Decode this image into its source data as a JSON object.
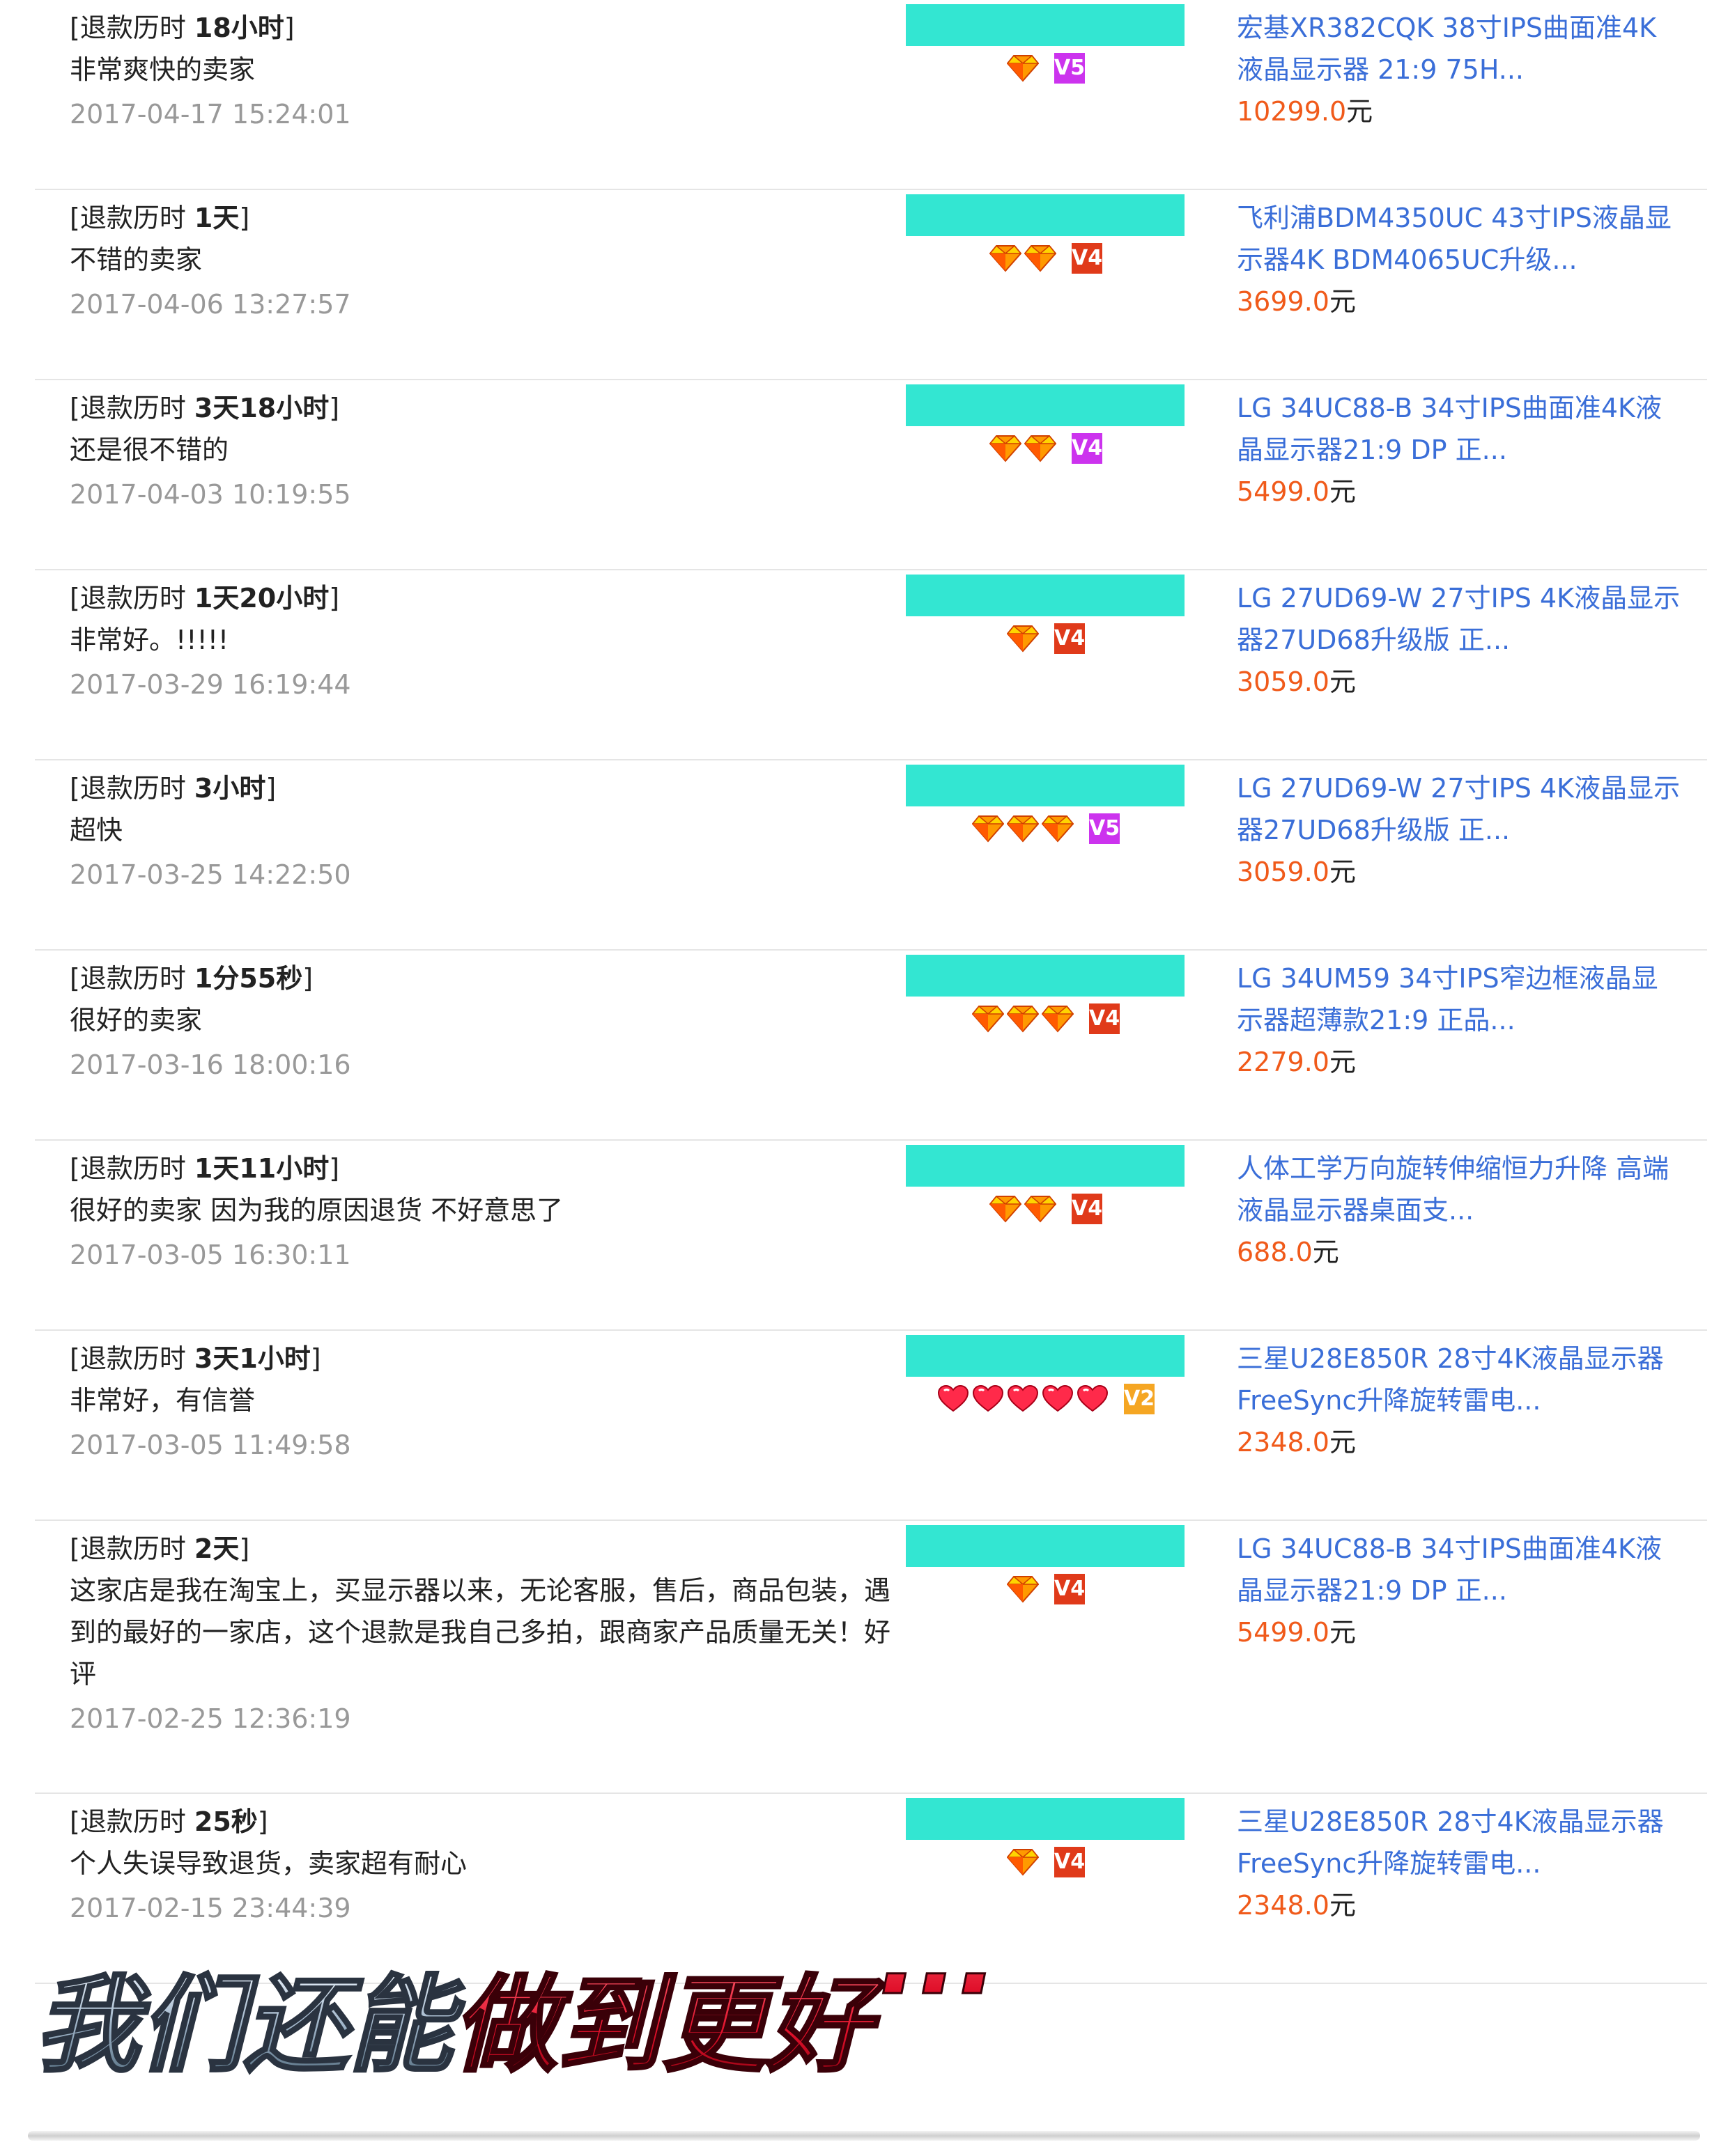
{
  "colors": {
    "bar": "#33e6d2",
    "link": "#3a6ed8",
    "price": "#f05a1a",
    "date": "#999999",
    "badge_purple": "#cc33ee",
    "badge_red": "#e03a1a",
    "badge_orange": "#f5a623"
  },
  "reviews": [
    {
      "refund_prefix": "[退款历时 ",
      "duration": "18小时",
      "refund_suffix": "]",
      "comment": "非常爽快的卖家",
      "date": "2017-04-17 15:24:01",
      "badge": {
        "icon": "diamond-icon",
        "count": 1,
        "level_icon": "v5-purple-badge-icon",
        "level_text": "V5"
      },
      "product": "宏基XR382CQK 38寸IPS曲面准4K液晶显示器 21:9 75H...",
      "price": "10299.0",
      "currency": "元"
    },
    {
      "refund_prefix": "[退款历时 ",
      "duration": "1天",
      "refund_suffix": "]",
      "comment": "不错的卖家",
      "date": "2017-04-06 13:27:57",
      "badge": {
        "icon": "diamond-icon",
        "count": 2,
        "level_icon": "v4-red-badge-icon",
        "level_text": "V4"
      },
      "product": "飞利浦BDM4350UC 43寸IPS液晶显示器4K BDM4065UC升级...",
      "price": "3699.0",
      "currency": "元"
    },
    {
      "refund_prefix": "[退款历时 ",
      "duration": "3天18小时",
      "refund_suffix": "]",
      "comment": "还是很不错的",
      "date": "2017-04-03 10:19:55",
      "badge": {
        "icon": "diamond-icon",
        "count": 2,
        "level_icon": "v4-purple-badge-icon",
        "level_text": "V4"
      },
      "product": "LG 34UC88-B 34寸IPS曲面准4K液晶显示器21:9 DP 正...",
      "price": "5499.0",
      "currency": "元"
    },
    {
      "refund_prefix": "[退款历时 ",
      "duration": "1天20小时",
      "refund_suffix": "]",
      "comment": "非常好。!!!!!",
      "date": "2017-03-29 16:19:44",
      "badge": {
        "icon": "diamond-icon",
        "count": 1,
        "level_icon": "v4-red-badge-icon",
        "level_text": "V4"
      },
      "product": "LG 27UD69-W 27寸IPS 4K液晶显示器27UD68升级版 正...",
      "price": "3059.0",
      "currency": "元"
    },
    {
      "refund_prefix": "[退款历时 ",
      "duration": "3小时",
      "refund_suffix": "]",
      "comment": "超快",
      "date": "2017-03-25 14:22:50",
      "badge": {
        "icon": "diamond-icon",
        "count": 3,
        "level_icon": "v5-purple-badge-icon",
        "level_text": "V5"
      },
      "product": "LG 27UD69-W 27寸IPS 4K液晶显示器27UD68升级版 正...",
      "price": "3059.0",
      "currency": "元"
    },
    {
      "refund_prefix": "[退款历时 ",
      "duration": "1分55秒",
      "refund_suffix": "]",
      "comment": "很好的卖家",
      "date": "2017-03-16 18:00:16",
      "badge": {
        "icon": "diamond-icon",
        "count": 3,
        "level_icon": "v4-red-badge-icon",
        "level_text": "V4"
      },
      "product": "LG 34UM59 34寸IPS窄边框液晶显示器超薄款21:9 正品...",
      "price": "2279.0",
      "currency": "元"
    },
    {
      "refund_prefix": "[退款历时 ",
      "duration": "1天11小时",
      "refund_suffix": "]",
      "comment": "很好的卖家 因为我的原因退货 不好意思了",
      "date": "2017-03-05 16:30:11",
      "badge": {
        "icon": "diamond-icon",
        "count": 2,
        "level_icon": "v4-red-badge-icon",
        "level_text": "V4"
      },
      "product": "人体工学万向旋转伸缩恒力升降 高端液晶显示器桌面支...",
      "price": "688.0",
      "currency": "元"
    },
    {
      "refund_prefix": "[退款历时 ",
      "duration": "3天1小时",
      "refund_suffix": "]",
      "comment": "非常好，有信誉",
      "date": "2017-03-05 11:49:58",
      "badge": {
        "icon": "heart-icon",
        "count": 5,
        "level_icon": "v2-orange-badge-icon",
        "level_text": "V2"
      },
      "product": "三星U28E850R 28寸4K液晶显示器FreeSync升降旋转雷电...",
      "price": "2348.0",
      "currency": "元"
    },
    {
      "refund_prefix": "[退款历时 ",
      "duration": "2天",
      "refund_suffix": "]",
      "comment": "这家店是我在淘宝上，买显示器以来，无论客服，售后，商品包装，遇到的最好的一家店，这个退款是我自己多拍，跟商家产品质量无关！好评",
      "date": "2017-02-25 12:36:19",
      "badge": {
        "icon": "diamond-icon",
        "count": 1,
        "level_icon": "v4-red-badge-icon",
        "level_text": "V4"
      },
      "product": "LG 34UC88-B 34寸IPS曲面准4K液晶显示器21:9 DP 正...",
      "price": "5499.0",
      "currency": "元"
    },
    {
      "refund_prefix": "[退款历时 ",
      "duration": "25秒",
      "refund_suffix": "]",
      "comment": "个人失误导致退货，卖家超有耐心",
      "date": "2017-02-15 23:44:39",
      "badge": {
        "icon": "diamond-icon",
        "count": 1,
        "level_icon": "v4-red-badge-icon",
        "level_text": "V4"
      },
      "product": "三星U28E850R 28寸4K液晶显示器FreeSync升降旋转雷电...",
      "price": "2348.0",
      "currency": "元"
    }
  ],
  "banner": {
    "text_part1": "我们还能",
    "text_part2": "做到更好",
    "dots": "···"
  }
}
